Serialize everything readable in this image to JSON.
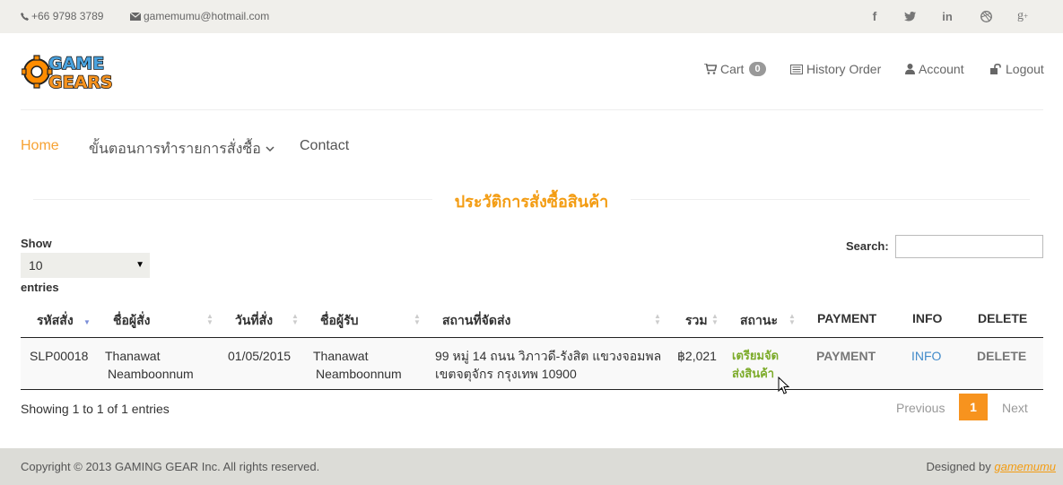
{
  "topbar": {
    "phone": "+66 9798 3789",
    "email": "gamemumu@hotmail.com",
    "social_icons": [
      "facebook-icon",
      "twitter-icon",
      "linkedin-icon",
      "dribbble-icon",
      "google-plus-icon"
    ]
  },
  "header": {
    "logo_text_top": "GAME",
    "logo_text_bottom": "GEARS",
    "cart_label": "Cart",
    "cart_count": "0",
    "history_label": "History Order",
    "account_label": "Account",
    "logout_label": "Logout"
  },
  "nav": {
    "home": "Home",
    "steps": "ขั้นตอนการทำรายการสั่งซื้อ",
    "contact": "Contact"
  },
  "page_title": "ประวัติการสั่งซื้อสินค้า",
  "table_controls": {
    "show_label": "Show",
    "entries_value": "10",
    "entries_label": "entries",
    "search_label": "Search:",
    "search_value": ""
  },
  "table": {
    "columns": [
      "รหัสสั่ง",
      "ชื่อผู้สั่ง",
      "วันที่สั่ง",
      "ชื่อผู้รับ",
      "สถานที่จัดส่ง",
      "รวม",
      "สถานะ",
      "PAYMENT",
      "INFO",
      "DELETE"
    ],
    "rows": [
      {
        "order_id": "SLP00018",
        "orderer_line1": "Thanawat",
        "orderer_line2": "Neamboonnum",
        "date": "01/05/2015",
        "receiver_line1": "Thanawat",
        "receiver_line2": "Neamboonnum",
        "address_line1": "99 หมู่ 14 ถนน วิภาวดี-รังสิต แขวงจอมพล",
        "address_line2": "เขตจตุจักร กรุงเทพ 10900",
        "total": "฿2,021",
        "status_line1": "เตรียมจัด",
        "status_line2": "ส่งสินค้า",
        "payment": "PAYMENT",
        "info": "INFO",
        "delete": "DELETE"
      }
    ]
  },
  "pagination": {
    "summary": "Showing 1 to 1 of 1 entries",
    "previous": "Previous",
    "current": "1",
    "next": "Next"
  },
  "footer": {
    "copyright": "Copyright © 2013 GAMING GEAR Inc. All rights reserved.",
    "designed_by": "Designed by",
    "designer": "gamemumu"
  },
  "colors": {
    "accent": "#f39c12",
    "status": "#7cab2a",
    "link": "#428bca"
  }
}
